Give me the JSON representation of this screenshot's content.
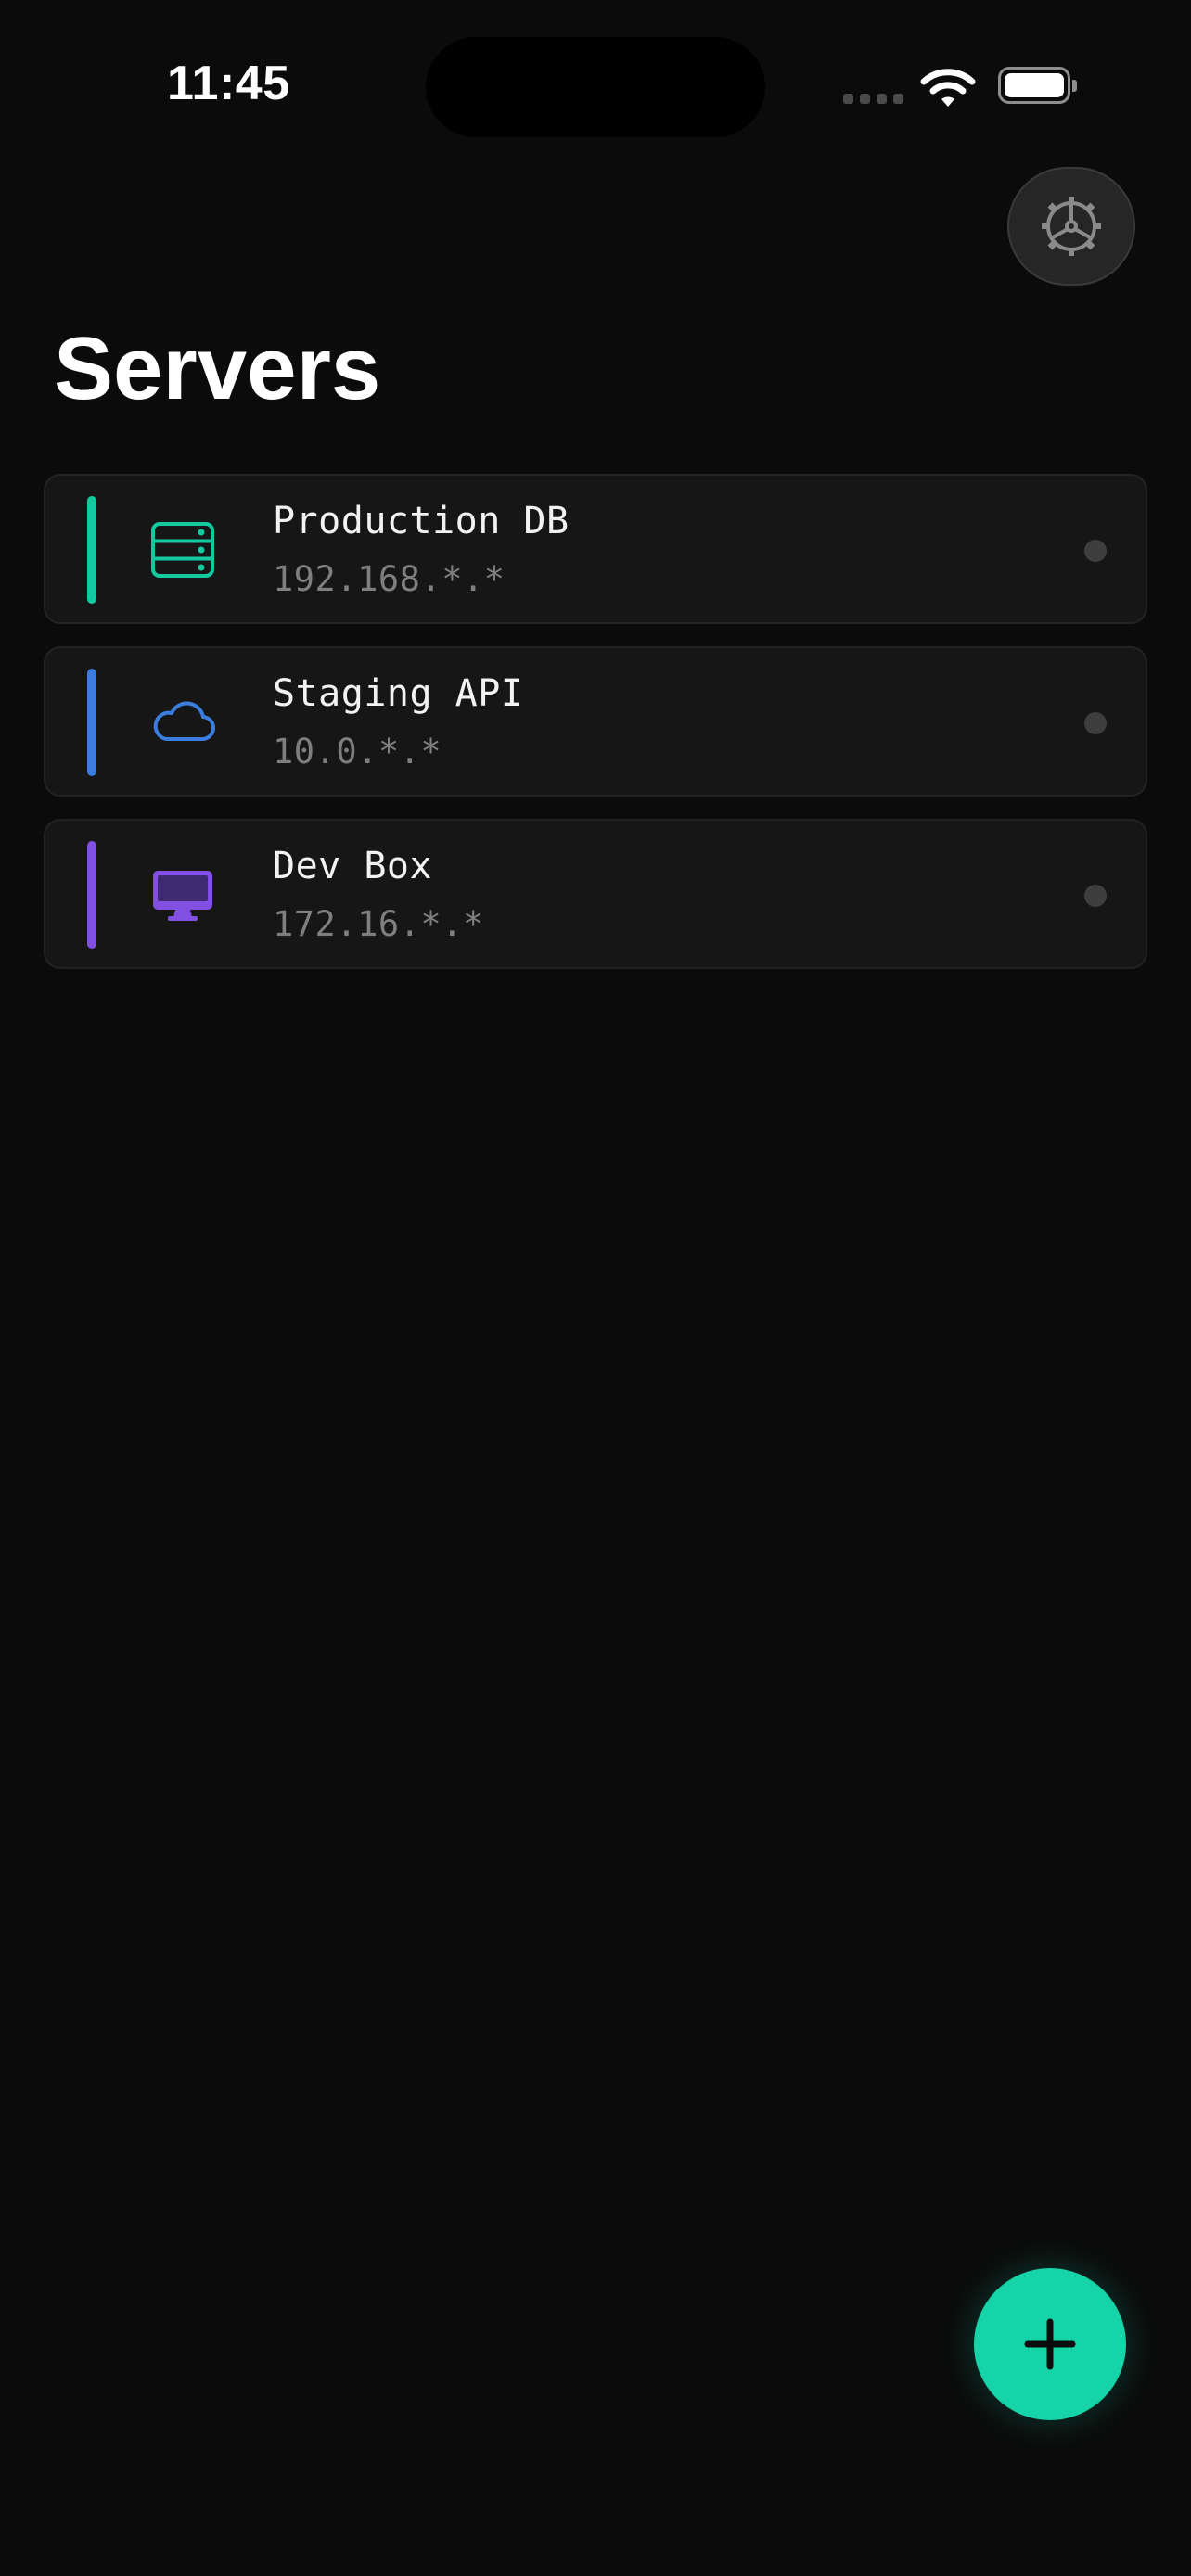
{
  "status_bar": {
    "time": "11:45"
  },
  "header": {
    "title": "Servers",
    "settings_icon": "gear-icon"
  },
  "servers": [
    {
      "name": "Production DB",
      "address": "192.168.*.*",
      "icon": "server-rack-icon",
      "accent": "#14c9a0",
      "status": "offline"
    },
    {
      "name": "Staging API",
      "address": "10.0.*.*",
      "icon": "cloud-icon",
      "accent": "#3b7ddd",
      "status": "offline"
    },
    {
      "name": "Dev Box",
      "address": "172.16.*.*",
      "icon": "desktop-icon",
      "accent": "#8250e0",
      "status": "offline"
    }
  ],
  "fab": {
    "icon": "plus-icon",
    "color": "#14d4a8"
  }
}
